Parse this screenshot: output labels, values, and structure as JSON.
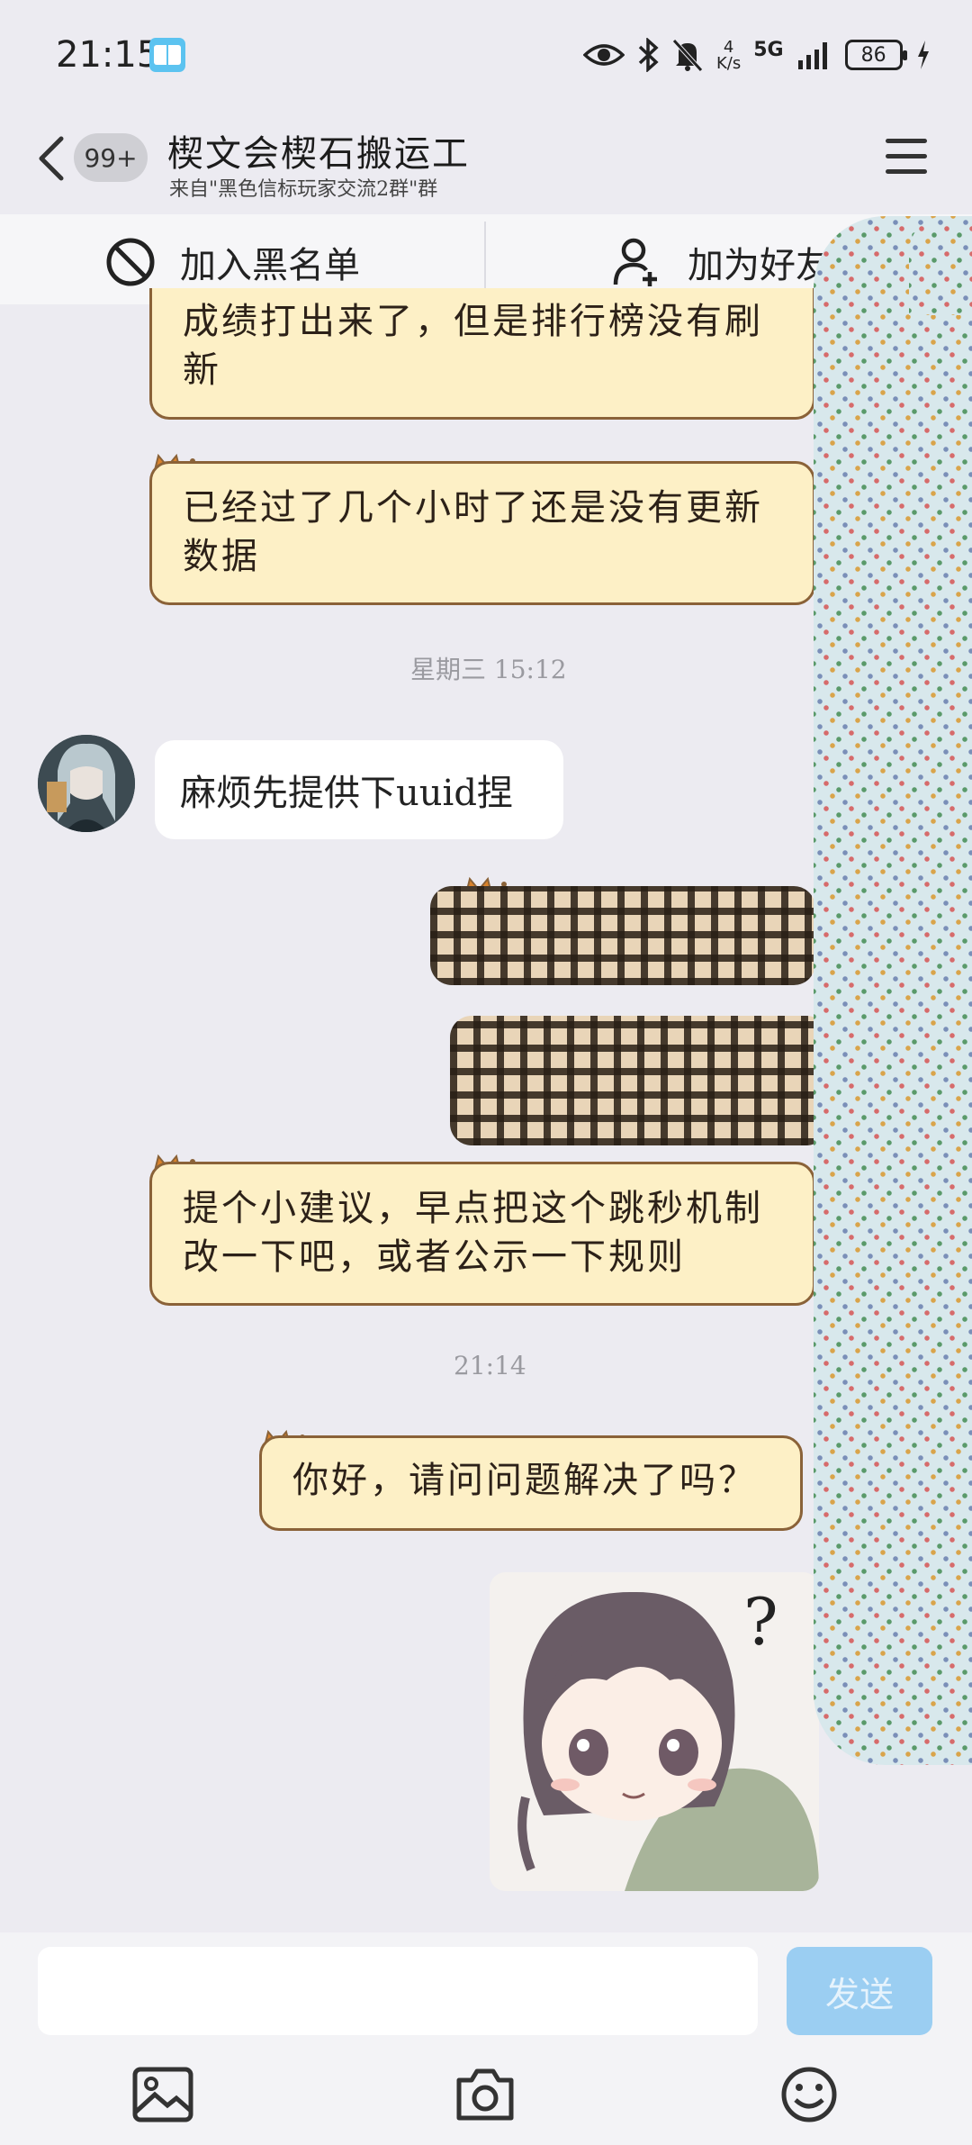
{
  "status_bar": {
    "time": "21:15",
    "net_speed_value": "4",
    "net_speed_unit": "K/s",
    "network": "5G",
    "battery": "86"
  },
  "header": {
    "badge": "99+",
    "title": "楔文会楔石搬运工",
    "subtitle": "来自\"黑色信标玩家交流2群\"群"
  },
  "actions": {
    "block_label": "加入黑名单",
    "add_friend_label": "加为好友"
  },
  "messages": {
    "m1": "成绩打出来了，但是排行榜没有刷新",
    "m2": "已经过了几个小时了还是没有更新数据",
    "t1": "星期三 15:12",
    "m3": "麻烦先提供下uuid捏",
    "m4": "提个小建议，早点把这个跳秒机制改一下吧，或者公示一下规则",
    "t2": "21:14",
    "m5": "你好，请问问题解决了吗？"
  },
  "input": {
    "placeholder": "",
    "send_label": "发送"
  },
  "colors": {
    "background": "#ecebf1",
    "bubble_fill": "#fdf0c6",
    "bubble_border": "#8a6238",
    "send_button": "#9bcef2"
  }
}
